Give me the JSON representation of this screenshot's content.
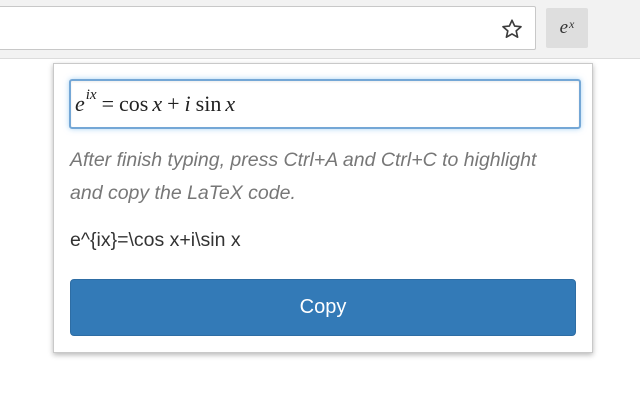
{
  "browser": {
    "star_icon": "star-outline-icon",
    "extension_button": {
      "base": "e",
      "exponent": "x",
      "icon": "exponent-function-icon"
    }
  },
  "popup": {
    "math_field": {
      "base": "e",
      "exponent": "ix",
      "equals": "=",
      "cos": "cos",
      "var1": "x",
      "plus": "+",
      "imag": "i",
      "sin": "sin",
      "var2": "x"
    },
    "instructions": "After finish typing, press Ctrl+A and Ctrl+C to highlight and copy the LaTeX code.",
    "latex_code": "e^{ix}=\\cos x+i\\sin x",
    "copy_label": "Copy"
  },
  "colors": {
    "copy_button": "#337ab7",
    "focus_border": "#74a7d6",
    "hint_text": "#777777"
  }
}
